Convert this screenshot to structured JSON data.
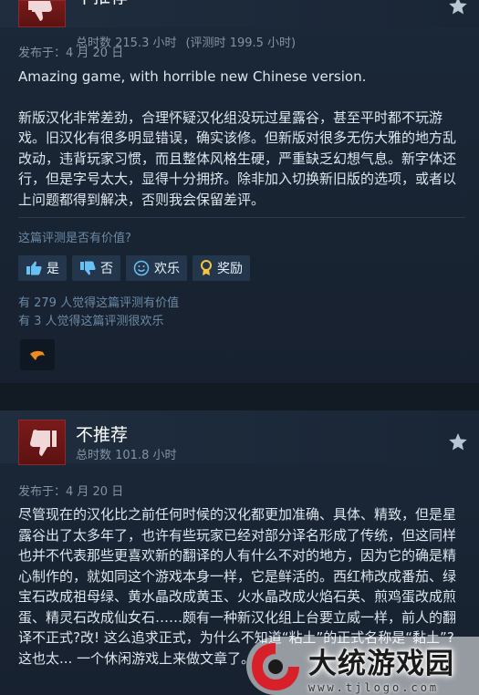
{
  "review1": {
    "verdict": "不推荐",
    "hours": "总时数 215.3 小时",
    "hours_at_review": "(评测时 199.5 小时)",
    "date": "发布于：4 月 20 日",
    "paragraphs": [
      "Amazing game, with horrible new Chinese version.",
      "新版汉化非常差劲，合理怀疑汉化组没玩过星露谷，甚至平时都不玩游戏。旧汉化有很多明显错误，确实该修。但新版对很多无伤大雅的地方乱改动，违背玩家习惯，而且整体风格生硬，严重缺乏幻想气息。新字体还行，但是字号太大，显得十分拥挤。除非加入切换新旧版的选项，或者以上问题都得到解决，否则我会保留差评。"
    ],
    "question": "这篇评测是否有价值?",
    "buttons": {
      "yes": "是",
      "no": "否",
      "funny": "欢乐",
      "award": "奖励"
    },
    "stats": [
      "有 279 人觉得这篇评测有价值",
      "有 3 人觉得这篇评测很欢乐"
    ]
  },
  "review2": {
    "verdict": "不推荐",
    "hours": "总时数 101.8 小时",
    "date": "发布于：4 月 20 日",
    "paragraph": "尽管现在的汉化比之前任何时候的汉化都更加准确、具体、精致，但是星露谷出了太多年了，也许有些玩家已经对部分译名形成了传统，但这同样也并不代表那些更喜欢新的翻译的人有什么不对的地方，因为它的确是精心制作的，就如同这个游戏本身一样，它是鲜活的。西红柿改成番茄、绿宝石改成祖母绿、黄水晶改成黄玉、火水晶改成火焰石英、煎鸡蛋改成煎蛋、精灵石改成仙女石……颇有一种新汉化组上台要立威一样，前人的翻译不正式?改! 这么追求正式，为什么不知道“粘土”的正式名称是“黏土”? 这也太... 一个休闲游戏上来做文章了。"
  },
  "watermark": {
    "title": "大统游戏园",
    "url": "www.tjlogo.com"
  },
  "colors": {
    "background": "#1b2838",
    "thumb_down": "#7a1a1a",
    "accent_blue": "#67c1f5",
    "award_gold": "#f5c542"
  },
  "icons": [
    "thumbs-down-icon",
    "star-icon",
    "thumbs-up-icon",
    "smiley-icon",
    "award-ribbon-icon",
    "reaction-emoji-icon"
  ]
}
